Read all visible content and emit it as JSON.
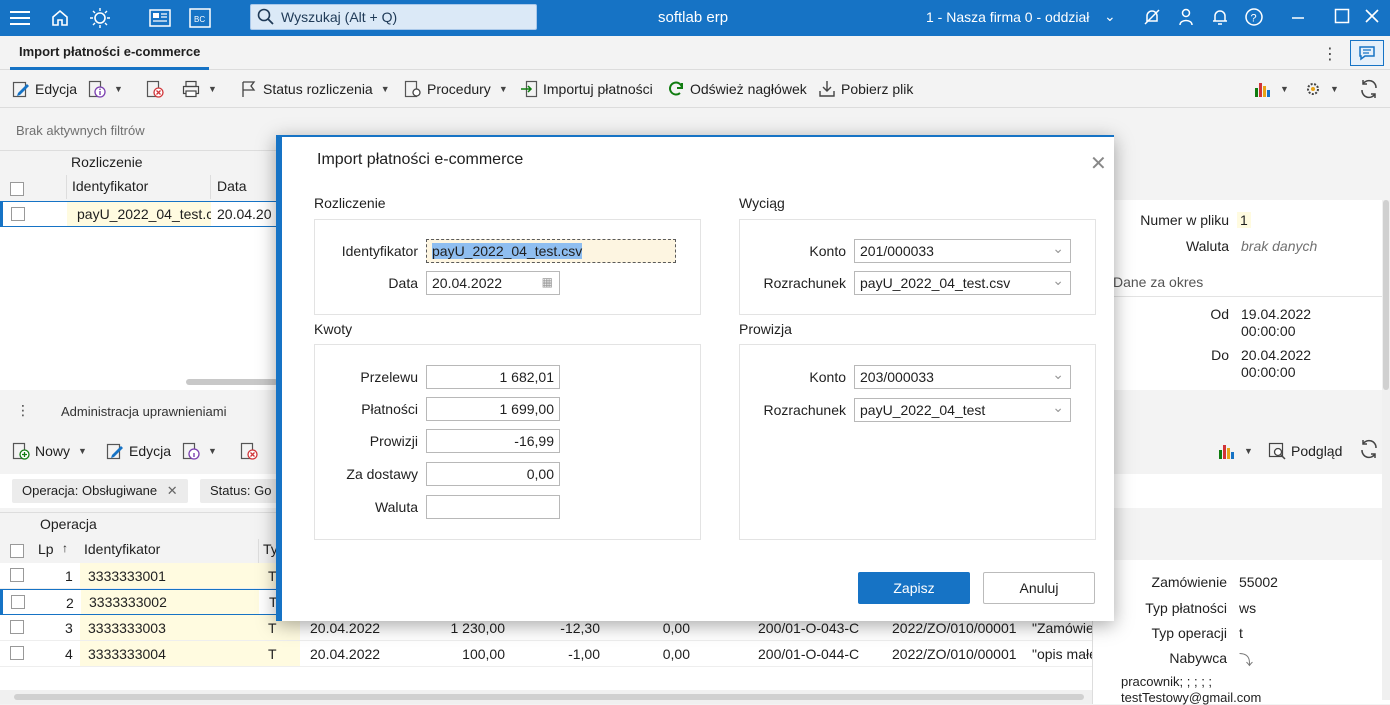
{
  "topbar": {
    "search_placeholder": "Wyszukaj (Alt + Q)",
    "brand": "softlab erp",
    "company": "1 - Nasza firma 0 - oddział"
  },
  "tab": {
    "title": "Import płatności e-commerce"
  },
  "toolbar": {
    "edit": "Edycja",
    "status": "Status rozliczenia",
    "procedures": "Procedury",
    "import": "Importuj płatności",
    "refresh_header": "Odśwież nagłówek",
    "download": "Pobierz plik"
  },
  "filters": {
    "none": "Brak aktywnych filtrów"
  },
  "grid1": {
    "group": "Rozliczenie",
    "col_id": "Identyfikator",
    "col_date": "Data",
    "row_id": "payU_2022_04_test.c",
    "row_date": "20.04.20"
  },
  "right_panel": {
    "numer_label": "Numer w pliku",
    "numer_value": "1",
    "waluta_label": "Waluta",
    "waluta_value": "brak danych",
    "period_title": "Dane za okres",
    "od_label": "Od",
    "od_date": "19.04.2022",
    "od_time": "00:00:00",
    "do_label": "Do",
    "do_date": "20.04.2022",
    "do_time": "00:00:00"
  },
  "section2": {
    "title": "Administracja uprawnieniami"
  },
  "toolbar2": {
    "new": "Nowy",
    "edit": "Edycja",
    "preview": "Podgląd"
  },
  "chips": {
    "op_label": "Operacja: ",
    "op_value": "Obsługiwane",
    "status_label": "Status: ",
    "status_value": "Go"
  },
  "grid2": {
    "group": "Operacja",
    "col_lp": "Lp",
    "col_id": "Identyfikator",
    "col_typ": "Ty",
    "rows": [
      {
        "lp": "1",
        "id": "3333333001",
        "typ": "T",
        "date": "",
        "amount": "",
        "commission": "",
        "zero": "",
        "account": "",
        "order": "",
        "note": ""
      },
      {
        "lp": "2",
        "id": "3333333002",
        "typ": "T",
        "date": "",
        "amount": "",
        "commission": "",
        "zero": "",
        "account": "",
        "order": "",
        "note": ""
      },
      {
        "lp": "3",
        "id": "3333333003",
        "typ": "T",
        "date": "20.04.2022",
        "amount": "1 230,00",
        "commission": "-12,30",
        "zero": "0,00",
        "account": "200/01-O-043-C",
        "order": "2022/ZO/010/00001",
        "note": "\"Zamówie"
      },
      {
        "lp": "4",
        "id": "3333333004",
        "typ": "T",
        "date": "20.04.2022",
        "amount": "100,00",
        "commission": "-1,00",
        "zero": "0,00",
        "account": "200/01-O-044-C",
        "order": "2022/ZO/010/00001",
        "note": "\"opis małe"
      }
    ]
  },
  "panel2": {
    "order_label": "Zamówienie",
    "order_value": "55002",
    "pay_label": "Typ płatności",
    "pay_value": "ws",
    "op_label": "Typ operacji",
    "op_value": "t",
    "buyer_label": "Nabywca",
    "buyer_line1": "pracownik; ; ; ; ;",
    "buyer_line2": "testTestowy@gmail.com"
  },
  "modal": {
    "title": "Import płatności e-commerce",
    "rozliczenie": {
      "title": "Rozliczenie",
      "id_label": "Identyfikator",
      "id_value": "payU_2022_04_test.csv",
      "date_label": "Data",
      "date_value": "20.04.2022"
    },
    "kwoty": {
      "title": "Kwoty",
      "przelewu_label": "Przelewu",
      "przelewu_value": "1 682,01",
      "platnosci_label": "Płatności",
      "platnosci_value": "1 699,00",
      "prowizji_label": "Prowizji",
      "prowizji_value": "-16,99",
      "dostawy_label": "Za dostawy",
      "dostawy_value": "0,00",
      "waluta_label": "Waluta",
      "waluta_value": ""
    },
    "wyciag": {
      "title": "Wyciąg",
      "konto_label": "Konto",
      "konto_value": "201/000033",
      "rozr_label": "Rozrachunek",
      "rozr_value": "payU_2022_04_test.csv"
    },
    "prowizja": {
      "title": "Prowizja",
      "konto_label": "Konto",
      "konto_value": "203/000033",
      "rozr_label": "Rozrachunek",
      "rozr_value": "payU_2022_04_test"
    },
    "save": "Zapisz",
    "cancel": "Anuluj"
  }
}
